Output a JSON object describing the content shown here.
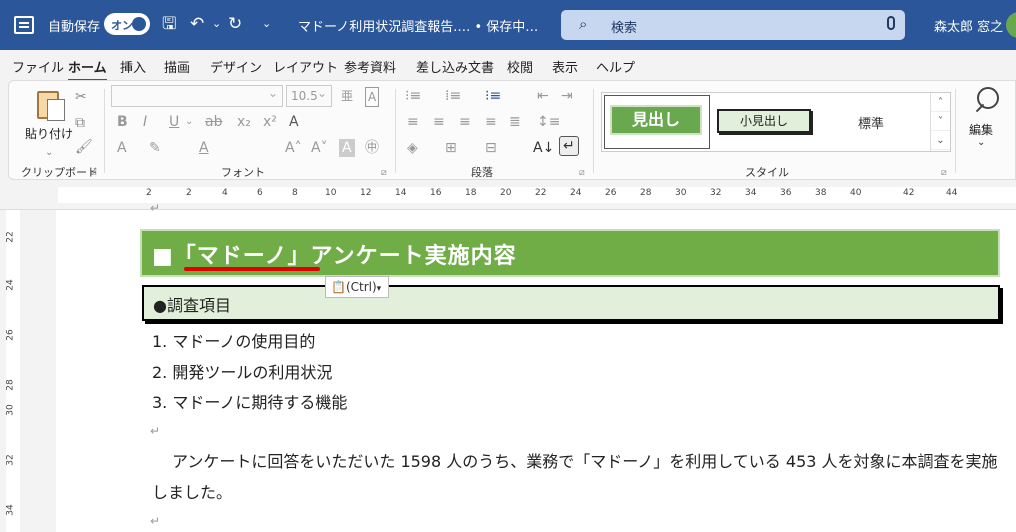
{
  "titlebar": {
    "autosave_label": "自動保存",
    "autosave_toggle": "オン",
    "doc_title": "マドーノ利用状況調査報告.… • 保存中…",
    "search_placeholder": "検索",
    "user_name": "森太郎 窓之",
    "icons": [
      "word-icon",
      "save-icon",
      "undo-icon",
      "redo-icon",
      "customize-icon"
    ]
  },
  "menu": [
    "ファイル",
    "ホーム",
    "挿入",
    "描画",
    "デザイン",
    "レイアウト",
    "参考資料",
    "差し込み文書",
    "校閲",
    "表示",
    "ヘルプ"
  ],
  "ribbon": {
    "clipboard": {
      "paste": "貼り付け",
      "label": "クリップボード"
    },
    "font": {
      "label": "フォント",
      "size": "10.5"
    },
    "paragraph": {
      "label": "段落"
    },
    "styles": {
      "label": "スタイル",
      "items": [
        "見出し",
        "小見出し",
        "標準"
      ]
    },
    "edit": {
      "label": "編集"
    }
  },
  "ruler_numbers": [
    "2",
    "2",
    "4",
    "6",
    "8",
    "10",
    "12",
    "14",
    "16",
    "18",
    "20",
    "22",
    "24",
    "26",
    "28",
    "30",
    "32",
    "34",
    "36",
    "38",
    "40",
    "42",
    "44"
  ],
  "vruler_numbers": [
    "22",
    "24",
    "26",
    "28",
    "30",
    "32",
    "34"
  ],
  "document": {
    "heading1": "■「マドーノ」アンケート実施内容",
    "paste_options": "(Ctrl)",
    "heading2": "●調査項目",
    "items": [
      "1.  マドーノの使用目的",
      "2.  開発ツールの利用状況",
      "3.  マドーノに期待する機能"
    ],
    "body": "アンケートに回答をいただいた 1598 人のうち、業務で「マドーノ」を利用している 453 人を対象に本調査を実施しました。",
    "para_mark": "↵"
  }
}
